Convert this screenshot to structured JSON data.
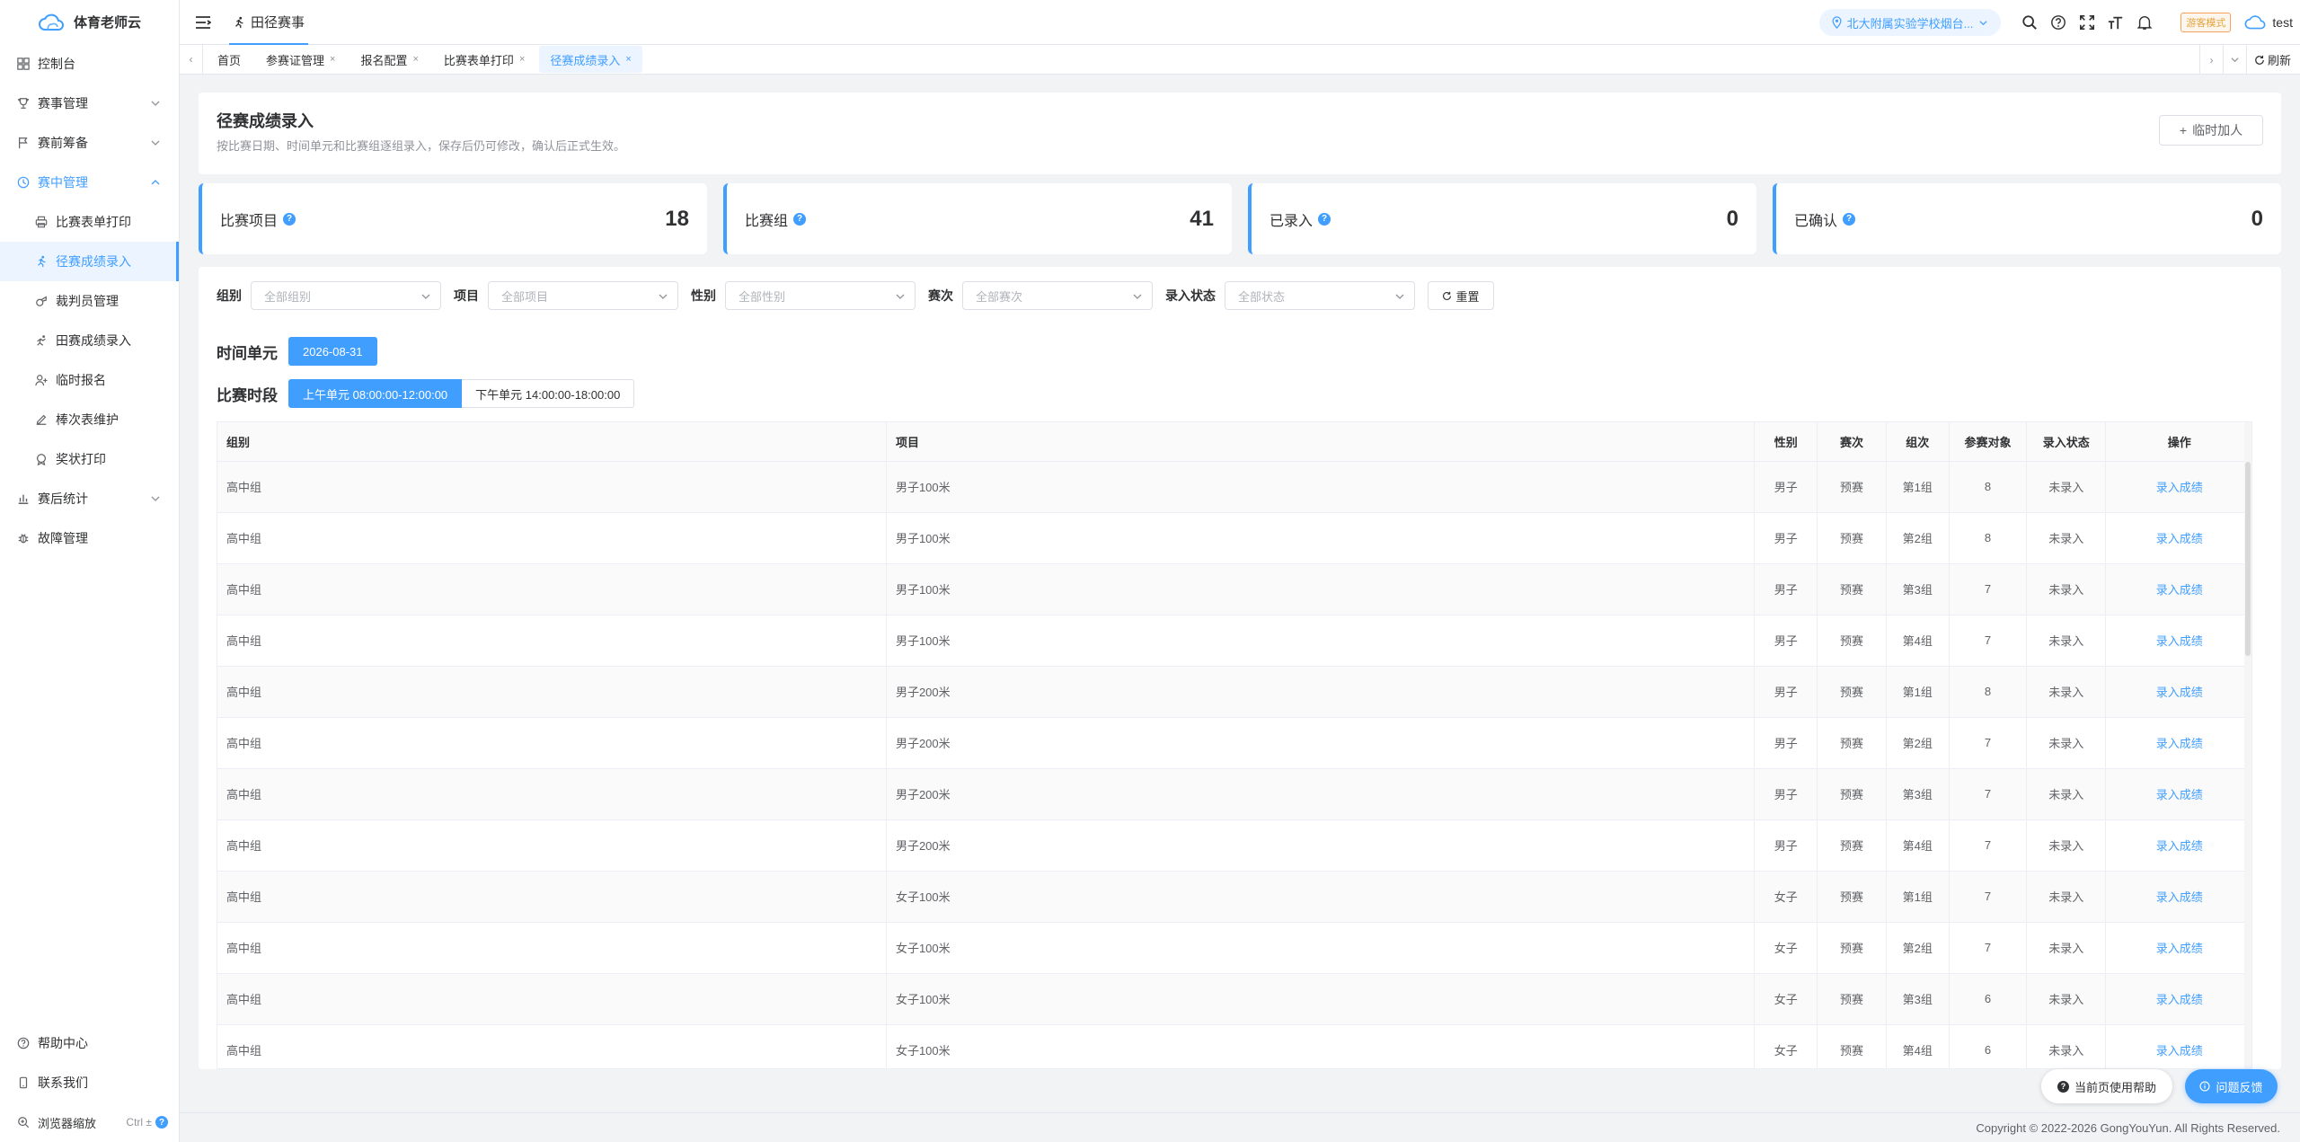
{
  "app": {
    "name": "体育老师云"
  },
  "header": {
    "breadcrumb": "田径赛事",
    "school": "北大附属实验学校烟台...",
    "mode_badge": "游客模式",
    "user": "test"
  },
  "sidebar": {
    "items": [
      {
        "label": "控制台",
        "icon": "dashboard-icon"
      },
      {
        "label": "赛事管理",
        "icon": "trophy-icon"
      },
      {
        "label": "赛前筹备",
        "icon": "flag-icon"
      },
      {
        "label": "赛中管理",
        "icon": "clock-icon"
      }
    ],
    "sub_items": [
      {
        "label": "比赛表单打印",
        "icon": "printer-icon"
      },
      {
        "label": "径赛成绩录入",
        "icon": "running-icon"
      },
      {
        "label": "裁判员管理",
        "icon": "whistle-icon"
      },
      {
        "label": "田赛成绩录入",
        "icon": "jump-icon"
      },
      {
        "label": "临时报名",
        "icon": "user-add-icon"
      },
      {
        "label": "棒次表维护",
        "icon": "edit-icon"
      },
      {
        "label": "奖状打印",
        "icon": "medal-icon"
      }
    ],
    "after_items": [
      {
        "label": "赛后统计",
        "icon": "chart-icon"
      },
      {
        "label": "故障管理",
        "icon": "bug-icon"
      }
    ],
    "bottom": {
      "help": "帮助中心",
      "contact": "联系我们",
      "zoom": "浏览器缩放",
      "zoom_shortcut": "Ctrl ±"
    }
  },
  "tabs": {
    "items": [
      {
        "label": "首页",
        "closable": false
      },
      {
        "label": "参赛证管理",
        "closable": true
      },
      {
        "label": "报名配置",
        "closable": true
      },
      {
        "label": "比赛表单打印",
        "closable": true
      },
      {
        "label": "径赛成绩录入",
        "closable": true,
        "active": true
      }
    ],
    "refresh": "刷新"
  },
  "page": {
    "title": "径赛成绩录入",
    "subtitle": "按比赛日期、时间单元和比赛组逐组录入，保存后仍可修改，确认后正式生效。",
    "add_button": "临时加人"
  },
  "stats": [
    {
      "label": "比赛项目",
      "value": "18"
    },
    {
      "label": "比赛组",
      "value": "41"
    },
    {
      "label": "已录入",
      "value": "0"
    },
    {
      "label": "已确认",
      "value": "0"
    }
  ],
  "filters": [
    {
      "label": "组别",
      "placeholder": "全部组别"
    },
    {
      "label": "项目",
      "placeholder": "全部项目"
    },
    {
      "label": "性别",
      "placeholder": "全部性别"
    },
    {
      "label": "赛次",
      "placeholder": "全部赛次"
    },
    {
      "label": "录入状态",
      "placeholder": "全部状态"
    }
  ],
  "reset_button": "重置",
  "time_unit": {
    "label": "时间单元",
    "date": "2026-08-31"
  },
  "segment": {
    "label": "比赛时段",
    "options": [
      "上午单元 08:00:00-12:00:00",
      "下午单元 14:00:00-18:00:00"
    ],
    "selected": 0
  },
  "table": {
    "columns": [
      "组别",
      "项目",
      "性别",
      "赛次",
      "组次",
      "参赛对象",
      "录入状态",
      "操作"
    ],
    "rows": [
      [
        "高中组",
        "男子100米",
        "男子",
        "预赛",
        "第1组",
        "8",
        "未录入",
        "录入成绩"
      ],
      [
        "高中组",
        "男子100米",
        "男子",
        "预赛",
        "第2组",
        "8",
        "未录入",
        "录入成绩"
      ],
      [
        "高中组",
        "男子100米",
        "男子",
        "预赛",
        "第3组",
        "7",
        "未录入",
        "录入成绩"
      ],
      [
        "高中组",
        "男子100米",
        "男子",
        "预赛",
        "第4组",
        "7",
        "未录入",
        "录入成绩"
      ],
      [
        "高中组",
        "男子200米",
        "男子",
        "预赛",
        "第1组",
        "8",
        "未录入",
        "录入成绩"
      ],
      [
        "高中组",
        "男子200米",
        "男子",
        "预赛",
        "第2组",
        "7",
        "未录入",
        "录入成绩"
      ],
      [
        "高中组",
        "男子200米",
        "男子",
        "预赛",
        "第3组",
        "7",
        "未录入",
        "录入成绩"
      ],
      [
        "高中组",
        "男子200米",
        "男子",
        "预赛",
        "第4组",
        "7",
        "未录入",
        "录入成绩"
      ],
      [
        "高中组",
        "女子100米",
        "女子",
        "预赛",
        "第1组",
        "7",
        "未录入",
        "录入成绩"
      ],
      [
        "高中组",
        "女子100米",
        "女子",
        "预赛",
        "第2组",
        "7",
        "未录入",
        "录入成绩"
      ],
      [
        "高中组",
        "女子100米",
        "女子",
        "预赛",
        "第3组",
        "6",
        "未录入",
        "录入成绩"
      ],
      [
        "高中组",
        "女子100米",
        "女子",
        "预赛",
        "第4组",
        "6",
        "未录入",
        "录入成绩"
      ]
    ]
  },
  "floating": {
    "help": "当前页使用帮助",
    "feedback": "问题反馈"
  },
  "footer": {
    "copyright": "Copyright © 2022-2026 GongYouYun. All Rights Reserved."
  },
  "colors": {
    "primary": "#409eff",
    "warning": "#e6a23c"
  }
}
